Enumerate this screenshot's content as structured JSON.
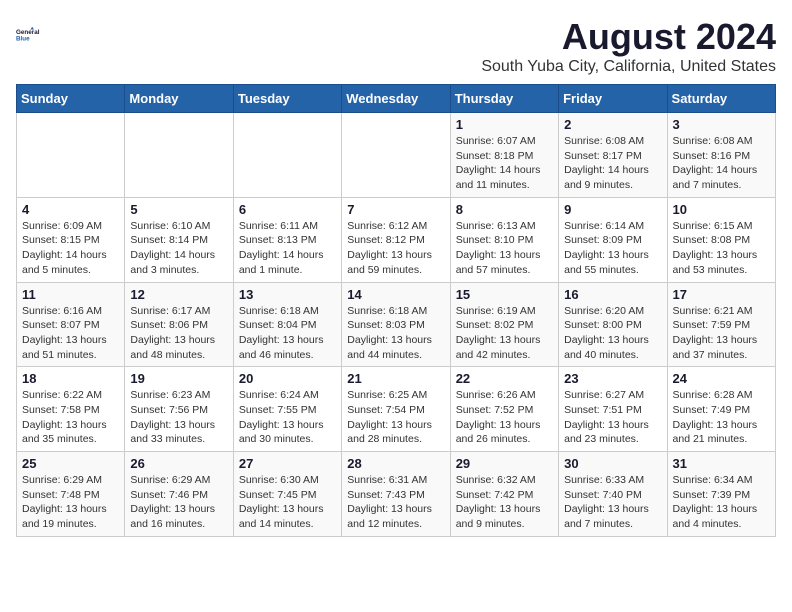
{
  "header": {
    "logo": {
      "line1": "General",
      "line2": "Blue"
    },
    "title": "August 2024",
    "subtitle": "South Yuba City, California, United States"
  },
  "weekdays": [
    "Sunday",
    "Monday",
    "Tuesday",
    "Wednesday",
    "Thursday",
    "Friday",
    "Saturday"
  ],
  "weeks": [
    [
      {
        "day": "",
        "info": ""
      },
      {
        "day": "",
        "info": ""
      },
      {
        "day": "",
        "info": ""
      },
      {
        "day": "",
        "info": ""
      },
      {
        "day": "1",
        "info": "Sunrise: 6:07 AM\nSunset: 8:18 PM\nDaylight: 14 hours\nand 11 minutes."
      },
      {
        "day": "2",
        "info": "Sunrise: 6:08 AM\nSunset: 8:17 PM\nDaylight: 14 hours\nand 9 minutes."
      },
      {
        "day": "3",
        "info": "Sunrise: 6:08 AM\nSunset: 8:16 PM\nDaylight: 14 hours\nand 7 minutes."
      }
    ],
    [
      {
        "day": "4",
        "info": "Sunrise: 6:09 AM\nSunset: 8:15 PM\nDaylight: 14 hours\nand 5 minutes."
      },
      {
        "day": "5",
        "info": "Sunrise: 6:10 AM\nSunset: 8:14 PM\nDaylight: 14 hours\nand 3 minutes."
      },
      {
        "day": "6",
        "info": "Sunrise: 6:11 AM\nSunset: 8:13 PM\nDaylight: 14 hours\nand 1 minute."
      },
      {
        "day": "7",
        "info": "Sunrise: 6:12 AM\nSunset: 8:12 PM\nDaylight: 13 hours\nand 59 minutes."
      },
      {
        "day": "8",
        "info": "Sunrise: 6:13 AM\nSunset: 8:10 PM\nDaylight: 13 hours\nand 57 minutes."
      },
      {
        "day": "9",
        "info": "Sunrise: 6:14 AM\nSunset: 8:09 PM\nDaylight: 13 hours\nand 55 minutes."
      },
      {
        "day": "10",
        "info": "Sunrise: 6:15 AM\nSunset: 8:08 PM\nDaylight: 13 hours\nand 53 minutes."
      }
    ],
    [
      {
        "day": "11",
        "info": "Sunrise: 6:16 AM\nSunset: 8:07 PM\nDaylight: 13 hours\nand 51 minutes."
      },
      {
        "day": "12",
        "info": "Sunrise: 6:17 AM\nSunset: 8:06 PM\nDaylight: 13 hours\nand 48 minutes."
      },
      {
        "day": "13",
        "info": "Sunrise: 6:18 AM\nSunset: 8:04 PM\nDaylight: 13 hours\nand 46 minutes."
      },
      {
        "day": "14",
        "info": "Sunrise: 6:18 AM\nSunset: 8:03 PM\nDaylight: 13 hours\nand 44 minutes."
      },
      {
        "day": "15",
        "info": "Sunrise: 6:19 AM\nSunset: 8:02 PM\nDaylight: 13 hours\nand 42 minutes."
      },
      {
        "day": "16",
        "info": "Sunrise: 6:20 AM\nSunset: 8:00 PM\nDaylight: 13 hours\nand 40 minutes."
      },
      {
        "day": "17",
        "info": "Sunrise: 6:21 AM\nSunset: 7:59 PM\nDaylight: 13 hours\nand 37 minutes."
      }
    ],
    [
      {
        "day": "18",
        "info": "Sunrise: 6:22 AM\nSunset: 7:58 PM\nDaylight: 13 hours\nand 35 minutes."
      },
      {
        "day": "19",
        "info": "Sunrise: 6:23 AM\nSunset: 7:56 PM\nDaylight: 13 hours\nand 33 minutes."
      },
      {
        "day": "20",
        "info": "Sunrise: 6:24 AM\nSunset: 7:55 PM\nDaylight: 13 hours\nand 30 minutes."
      },
      {
        "day": "21",
        "info": "Sunrise: 6:25 AM\nSunset: 7:54 PM\nDaylight: 13 hours\nand 28 minutes."
      },
      {
        "day": "22",
        "info": "Sunrise: 6:26 AM\nSunset: 7:52 PM\nDaylight: 13 hours\nand 26 minutes."
      },
      {
        "day": "23",
        "info": "Sunrise: 6:27 AM\nSunset: 7:51 PM\nDaylight: 13 hours\nand 23 minutes."
      },
      {
        "day": "24",
        "info": "Sunrise: 6:28 AM\nSunset: 7:49 PM\nDaylight: 13 hours\nand 21 minutes."
      }
    ],
    [
      {
        "day": "25",
        "info": "Sunrise: 6:29 AM\nSunset: 7:48 PM\nDaylight: 13 hours\nand 19 minutes."
      },
      {
        "day": "26",
        "info": "Sunrise: 6:29 AM\nSunset: 7:46 PM\nDaylight: 13 hours\nand 16 minutes."
      },
      {
        "day": "27",
        "info": "Sunrise: 6:30 AM\nSunset: 7:45 PM\nDaylight: 13 hours\nand 14 minutes."
      },
      {
        "day": "28",
        "info": "Sunrise: 6:31 AM\nSunset: 7:43 PM\nDaylight: 13 hours\nand 12 minutes."
      },
      {
        "day": "29",
        "info": "Sunrise: 6:32 AM\nSunset: 7:42 PM\nDaylight: 13 hours\nand 9 minutes."
      },
      {
        "day": "30",
        "info": "Sunrise: 6:33 AM\nSunset: 7:40 PM\nDaylight: 13 hours\nand 7 minutes."
      },
      {
        "day": "31",
        "info": "Sunrise: 6:34 AM\nSunset: 7:39 PM\nDaylight: 13 hours\nand 4 minutes."
      }
    ]
  ]
}
